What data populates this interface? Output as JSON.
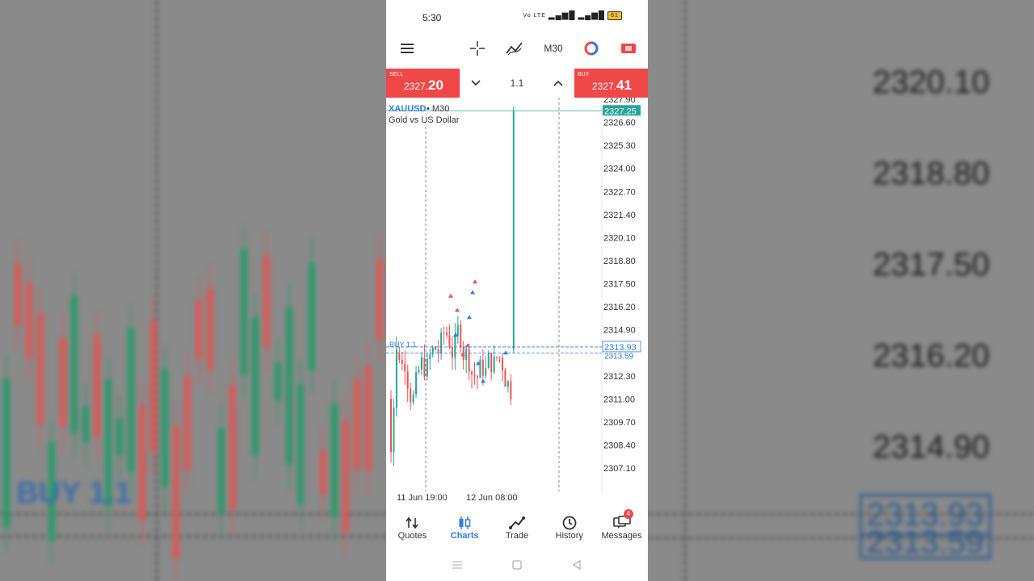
{
  "status_bar": {
    "time": "5:30",
    "signal_text": "Vo LTE",
    "battery": "61"
  },
  "toolbar": {
    "timeframe": "M30"
  },
  "trade_bar": {
    "sell_label": "SELL",
    "sell_price_main": "2327.",
    "sell_price_big": "20",
    "buy_label": "BUY",
    "buy_price_main": "2327.",
    "buy_price_big": "41",
    "volume": "1.1"
  },
  "chart": {
    "symbol": "XAUUSD",
    "timeframe": "M30",
    "description": "Gold vs US Dollar",
    "current_price_tag": "2327.25",
    "order_tag_1": "2313.93",
    "order_tag_2": "2313.59",
    "order_label": "BUY 1.1",
    "price_ticks": [
      "2327.90",
      "2326.60",
      "2325.30",
      "2324.00",
      "2322.70",
      "2321.40",
      "2320.10",
      "2318.80",
      "2317.50",
      "2316.20",
      "2314.90",
      "2312.30",
      "2311.00",
      "2309.70",
      "2308.40",
      "2307.10"
    ],
    "time_labels": [
      "11 Jun 19:00",
      "12 Jun 08:00"
    ],
    "colors": {
      "bull": "#26a69a",
      "bear": "#ef5350",
      "order_line": "#2e7de0",
      "price_tag": "#26a69a"
    }
  },
  "bottom_nav": [
    {
      "label": "Quotes",
      "icon": "quotes-icon"
    },
    {
      "label": "Charts",
      "icon": "charts-icon"
    },
    {
      "label": "Trade",
      "icon": "trade-icon"
    },
    {
      "label": "History",
      "icon": "history-icon"
    },
    {
      "label": "Messages",
      "icon": "messages-icon",
      "badge": "4"
    }
  ],
  "background": {
    "prices": [
      "2320.10",
      "2318.80",
      "2317.50",
      "2316.20",
      "2314.90"
    ],
    "box_1": "2313.93",
    "box_2": "2313.59",
    "buy_text": "BUY 1.1"
  }
}
